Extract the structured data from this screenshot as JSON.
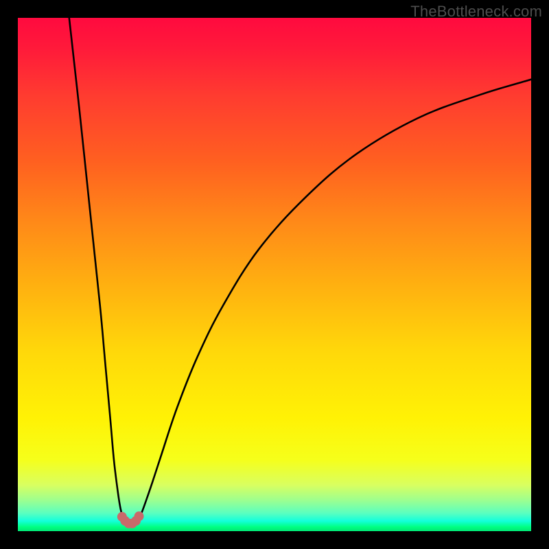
{
  "watermark": {
    "text": "TheBottleneck.com"
  },
  "chart_data": {
    "type": "line",
    "title": "",
    "xlabel": "",
    "ylabel": "",
    "xlim": [
      0,
      100
    ],
    "ylim": [
      0,
      100
    ],
    "gradient_colors": {
      "top": "#ff0a3f",
      "mid": "#ffe600",
      "bottom": "#00ff80",
      "meaning": "vertical gradient background from red (high) through yellow to green (low)"
    },
    "series": [
      {
        "name": "left-branch",
        "x": [
          10,
          12,
          14,
          16,
          17,
          18,
          18.7,
          19.3,
          19.8,
          20.2,
          20.6,
          21.0
        ],
        "values": [
          100,
          82,
          63,
          44,
          33,
          22,
          14,
          9,
          5.5,
          3.5,
          2.2,
          1.5
        ]
      },
      {
        "name": "right-branch",
        "x": [
          23.0,
          23.5,
          24.2,
          25.0,
          26.2,
          28.0,
          31.0,
          35.0,
          40.0,
          47.0,
          56.0,
          66.0,
          78.0,
          90.0,
          100.0
        ],
        "values": [
          1.5,
          2.3,
          3.8,
          6.0,
          9.5,
          15.0,
          24.0,
          34.0,
          44.0,
          55.0,
          65.0,
          73.5,
          80.5,
          85.0,
          88.0
        ]
      }
    ],
    "marker_cluster": {
      "name": "bottom-dots",
      "color": "#c86a6a",
      "points": [
        {
          "x": 20.3,
          "y": 2.8
        },
        {
          "x": 20.9,
          "y": 2.0
        },
        {
          "x": 21.6,
          "y": 1.5
        },
        {
          "x": 22.3,
          "y": 1.5
        },
        {
          "x": 23.0,
          "y": 2.0
        },
        {
          "x": 23.6,
          "y": 2.9
        }
      ]
    }
  }
}
